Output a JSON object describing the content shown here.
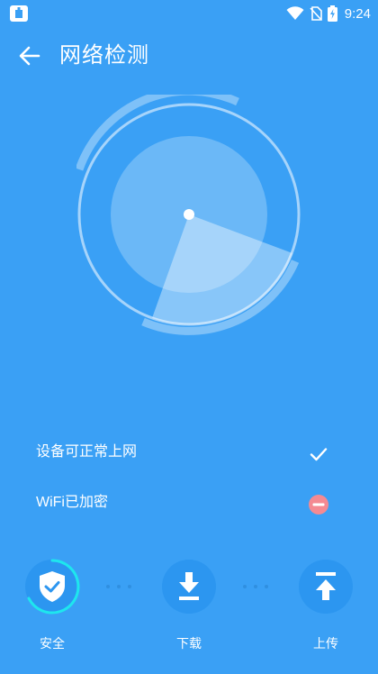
{
  "status_bar": {
    "time": "9:24",
    "battery_level": "charging",
    "icons": [
      "app-notification-icon",
      "wifi-icon",
      "no-sim-icon",
      "battery-charging-icon"
    ]
  },
  "header": {
    "title": "网络检测",
    "back_icon": "arrow-left-icon"
  },
  "radar": {
    "icons": [
      "radar-scanner",
      "center-dot"
    ]
  },
  "checks": [
    {
      "label": "设备可正常上网",
      "status": "ok",
      "icon": "check-icon"
    },
    {
      "label": "WiFi已加密",
      "status": "warning",
      "icon": "minus-circle-icon"
    }
  ],
  "steps": [
    {
      "label": "安全",
      "icon": "shield-check-icon",
      "state": "active"
    },
    {
      "label": "下载",
      "icon": "download-arrow-icon",
      "state": "pending"
    },
    {
      "label": "上传",
      "icon": "upload-arrow-icon",
      "state": "pending"
    }
  ],
  "colors": {
    "background": "#3aa0f5",
    "step_circle": "#2c96f0",
    "progress_ring": "#1ee6ee",
    "warning": "#f48a92"
  }
}
